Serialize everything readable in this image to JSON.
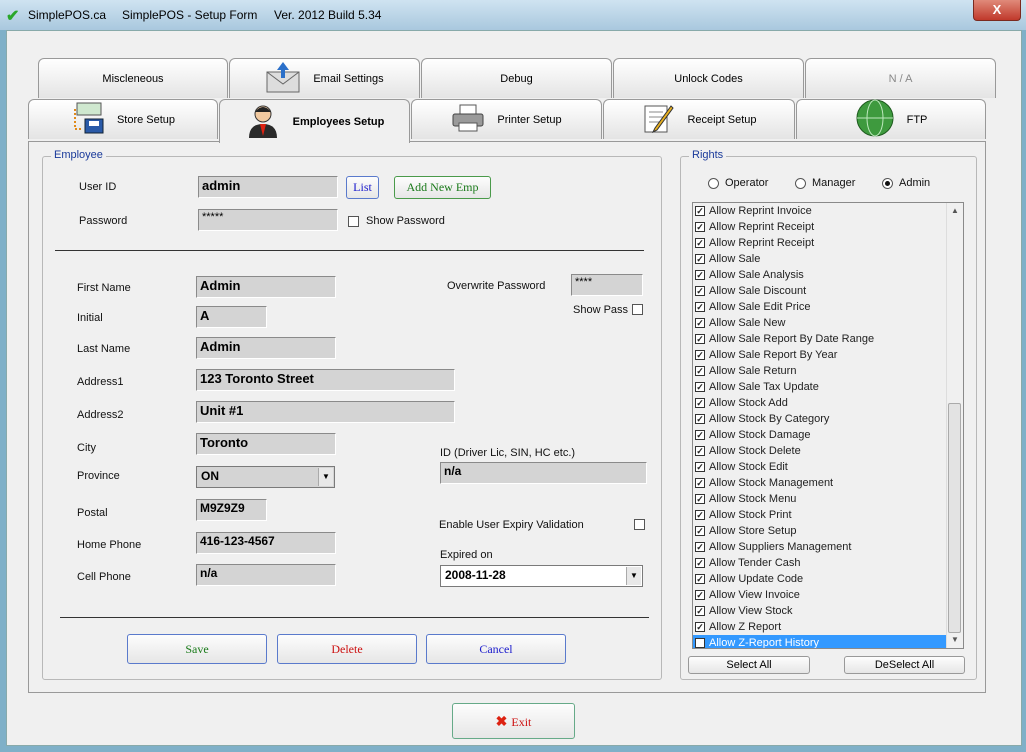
{
  "titlebar": {
    "app_name": "SimplePOS.ca",
    "title": "SimplePOS - Setup Form",
    "version": "Ver. 2012 Build 5.34",
    "close_glyph": "X"
  },
  "tabs_row1": [
    {
      "label": "Miscleneous",
      "icon": ""
    },
    {
      "label": "Email Settings",
      "icon": "email-icon"
    },
    {
      "label": "Debug",
      "icon": ""
    },
    {
      "label": "Unlock Codes",
      "icon": ""
    },
    {
      "label": "N / A",
      "icon": ""
    }
  ],
  "tabs_row2": [
    {
      "label": "Store Setup",
      "icon": "store-icon"
    },
    {
      "label": "Employees Setup",
      "icon": "employee-icon",
      "active": true
    },
    {
      "label": "Printer Setup",
      "icon": "printer-icon"
    },
    {
      "label": "Receipt Setup",
      "icon": "receipt-icon"
    },
    {
      "label": "FTP",
      "icon": "ftp-icon"
    }
  ],
  "employee": {
    "legend": "Employee",
    "user_id_label": "User ID",
    "user_id": "admin",
    "list_button": "List",
    "add_new_button": "Add New Emp",
    "password_label": "Password",
    "password": "*****",
    "show_password_label": "Show Password",
    "first_name_label": "First Name",
    "first_name": "Admin",
    "initial_label": "Initial",
    "initial": "A",
    "last_name_label": "Last Name",
    "last_name": "Admin",
    "address1_label": "Address1",
    "address1": "123 Toronto Street",
    "address2_label": "Address2",
    "address2": "Unit #1",
    "city_label": "City",
    "city": "Toronto",
    "province_label": "Province",
    "province": "ON",
    "postal_label": "Postal",
    "postal": "M9Z9Z9",
    "home_phone_label": "Home Phone",
    "home_phone": "416-123-4567",
    "cell_phone_label": "Cell Phone",
    "cell_phone": "n/a",
    "overwrite_password_label": "Overwrite Password",
    "overwrite_password": "****",
    "show_pass_label": "Show Pass",
    "id_label": "ID (Driver Lic, SIN, HC etc.)",
    "id_value": "n/a",
    "expiry_validation_label": "Enable User Expiry Validation",
    "expired_on_label": "Expired on",
    "expired_on": "2008-11-28",
    "save_button": "Save",
    "delete_button": "Delete",
    "cancel_button": "Cancel"
  },
  "rights": {
    "legend": "Rights",
    "roles": [
      "Operator",
      "Manager",
      "Admin"
    ],
    "selected_role": "Admin",
    "items": [
      "Allow Reprint Invoice",
      "Allow Reprint Receipt",
      "Allow Reprint Receipt",
      "Allow Sale",
      "Allow Sale Analysis",
      "Allow Sale Discount",
      "Allow Sale Edit Price",
      "Allow Sale New",
      "Allow Sale Report By Date Range",
      "Allow Sale Report By Year",
      "Allow Sale Return",
      "Allow Sale Tax Update",
      "Allow Stock Add",
      "Allow Stock By Category",
      "Allow Stock Damage",
      "Allow Stock Delete",
      "Allow Stock Edit",
      "Allow Stock Management",
      "Allow Stock Menu",
      "Allow Stock Print",
      "Allow Store Setup",
      "Allow Suppliers Management",
      "Allow Tender Cash",
      "Allow Update Code",
      "Allow View Invoice",
      "Allow View Stock",
      "Allow Z Report",
      "Allow Z-Report History"
    ],
    "selected_item": "Allow Z-Report History",
    "select_all_button": "Select All",
    "deselect_all_button": "DeSelect All"
  },
  "exit_button": "Exit",
  "colors": {
    "legend_blue": "#1a3a9a",
    "save_green": "#1a7a1a",
    "delete_red": "#cc1111",
    "cancel_blue": "#1a1acc",
    "selection_blue": "#3399ff"
  }
}
